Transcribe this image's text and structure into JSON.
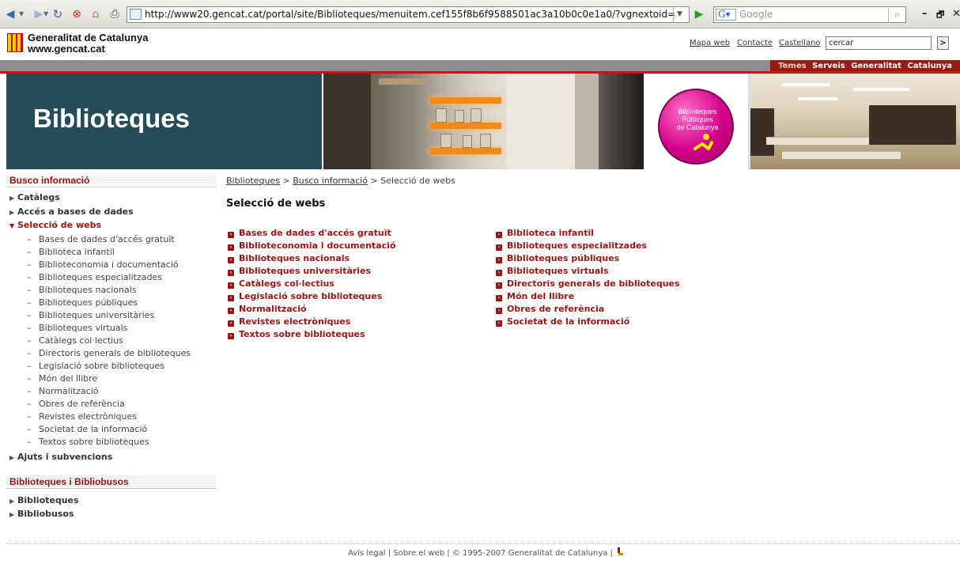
{
  "browser": {
    "url": "http://www20.gencat.cat/portal/site/Biblioteques/menuitem.cef155f8b6f9588501ac3a10b0c0e1a0/?vgnextoid=",
    "search_placeholder": "Google",
    "window_controls": [
      "–",
      "🗗",
      "✕"
    ]
  },
  "header": {
    "org_name": "Generalitat de Catalunya",
    "org_url": "www.gencat.cat",
    "links": [
      "Mapa web",
      "Contacte",
      "Castellano"
    ],
    "search_value": "cercar",
    "search_button": ">"
  },
  "topnav": [
    "Temes",
    "Serveis",
    "Generalitat",
    "Catalunya"
  ],
  "banner": {
    "title": "Biblioteques",
    "logo_text": [
      "Biblioteques",
      "Públiques",
      "de Catalunya"
    ]
  },
  "sidebar": {
    "section1_title": "Busco informació",
    "section1_items": [
      {
        "label": "Catàlegs"
      },
      {
        "label": "Accés a bases de dades"
      },
      {
        "label": "Selecció de webs"
      },
      {
        "label": "Ajuts i subvencions"
      }
    ],
    "sub_items": [
      "Bases de dades d'accés gratuït",
      "Biblioteca infantil",
      "Biblioteconomia i documentació",
      "Biblioteques especialitzades",
      "Biblioteques nacionals",
      "Biblioteques públiques",
      "Biblioteques universitàries",
      "Biblioteques virtuals",
      "Catàlegs col·lectius",
      "Directoris generals de biblioteques",
      "Legislació sobre biblioteques",
      "Món del llibre",
      "Normalització",
      "Obres de referència",
      "Revistes electròniques",
      "Societat de la informació",
      "Textos sobre biblioteques"
    ],
    "section2_title": "Biblioteques i Bibliobusos",
    "section2_items": [
      "Biblioteques",
      "Bibliobusos"
    ]
  },
  "breadcrumb": {
    "crumb1": "Biblioteques",
    "sep": ">",
    "crumb2": "Busco informació",
    "current": "Selecció de webs"
  },
  "main": {
    "title": "Selecció de webs",
    "col1": [
      "Bases de dades d'accés gratuït",
      "Biblioteconomia i documentació",
      "Biblioteques nacionals",
      "Biblioteques universitàries",
      "Catàlegs col·lectius",
      "Legislació sobre biblioteques",
      "Normalització",
      "Revistes electròniques",
      "Textos sobre biblioteques"
    ],
    "col2": [
      "Biblioteca infantil",
      "Biblioteques especialitzades",
      "Biblioteques públiques",
      "Biblioteques virtuals",
      "Directoris generals de biblioteques",
      "Món del llibre",
      "Obres de referència",
      "Societat de la informació"
    ]
  },
  "footer": {
    "legal": "Avís legal",
    "about": "Sobre el web",
    "copyright": "© 1995-2007 Generalitat de Catalunya"
  },
  "colors": {
    "accent_red": "#9a1612",
    "banner_teal": "#264c5a",
    "logo_magenta": "#d3008a"
  }
}
